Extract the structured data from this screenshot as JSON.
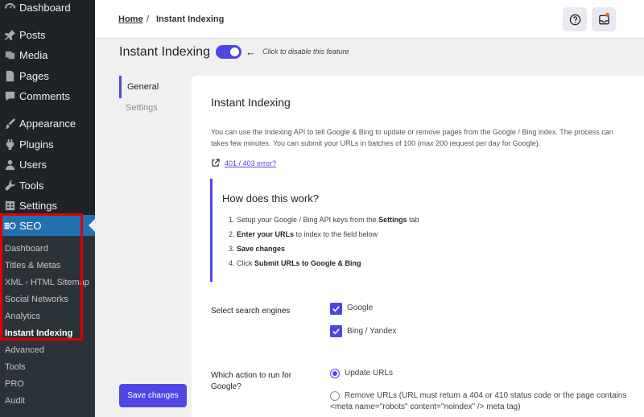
{
  "sidebar": {
    "items": [
      {
        "label": "Dashboard",
        "icon": "dashboard-icon"
      },
      {
        "label": "Posts",
        "icon": "pin-icon"
      },
      {
        "label": "Media",
        "icon": "media-icon"
      },
      {
        "label": "Pages",
        "icon": "page-icon"
      },
      {
        "label": "Comments",
        "icon": "comment-icon"
      },
      {
        "label": "Appearance",
        "icon": "brush-icon"
      },
      {
        "label": "Plugins",
        "icon": "plugin-icon"
      },
      {
        "label": "Users",
        "icon": "user-icon"
      },
      {
        "label": "Tools",
        "icon": "wrench-icon"
      },
      {
        "label": "Settings",
        "icon": "settings-icon"
      }
    ],
    "seo": {
      "label": "SEO",
      "icon": "seo-icon"
    },
    "submenu": [
      "Dashboard",
      "Titles & Metas",
      "XML - HTML Sitemap",
      "Social Networks",
      "Analytics",
      "Instant Indexing",
      "Advanced",
      "Tools",
      "PRO",
      "Audit"
    ]
  },
  "breadcrumb": {
    "home": "Home",
    "separator": "/",
    "current": "Instant Indexing"
  },
  "header": {
    "title": "Instant Indexing",
    "toggle_on": true,
    "toggle_hint": "Click to disable this feature",
    "accent_color": "#4f46e5"
  },
  "tabs": {
    "general": "General",
    "settings": "Settings"
  },
  "save_button": "Save changes",
  "card": {
    "title": "Instant Indexing",
    "description_line1": "You can use the Indexing API to tell Google & Bing to update or remove pages from the Google / Bing index. The process can",
    "description_line2": "takes few minutes. You can submit your URLs in batches of 100 (max 200 request per day for Google).",
    "error_link": "401 / 403 error?",
    "how": {
      "title": "How does this work?",
      "steps": [
        {
          "prefix": "1. Setup your Google / Bing API keys from the ",
          "bold": "Settings",
          "suffix": " tab"
        },
        {
          "prefix": "2. ",
          "bold": "Enter your URLs",
          "suffix": " to index to the field below"
        },
        {
          "prefix": "3. ",
          "bold": "Save changes",
          "suffix": ""
        },
        {
          "prefix": "4. Click ",
          "bold": "Submit URLs to Google & Bing",
          "suffix": ""
        }
      ]
    },
    "search_engines": {
      "label": "Select search engines",
      "options": [
        {
          "label": "Google",
          "checked": true
        },
        {
          "label": "Bing / Yandex",
          "checked": true
        }
      ]
    },
    "action": {
      "label_line1": "Which action to run for",
      "label_line2": "Google?",
      "options": [
        {
          "label": "Update URLs",
          "selected": true
        },
        {
          "label_line1": "Remove URLs (URL must return a 404 or 410 status code or the page contains",
          "label_line2": "<meta name=\"robots\" content=\"noindex\" /> meta tag)",
          "selected": false
        }
      ]
    }
  }
}
